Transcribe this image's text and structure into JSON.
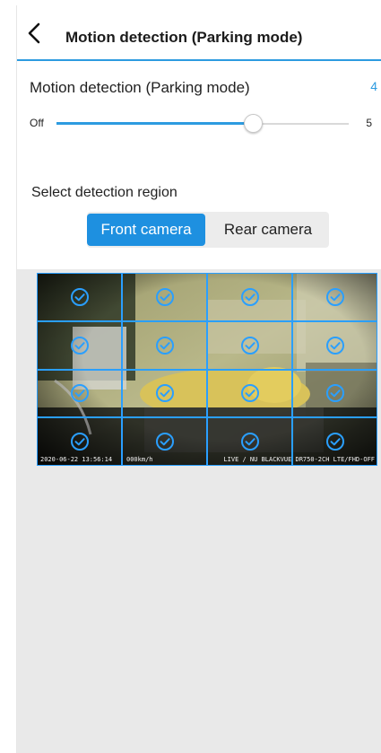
{
  "header": {
    "title": "Motion detection (Parking mode)"
  },
  "setting": {
    "title": "Motion detection (Parking mode)",
    "value": "4",
    "slider": {
      "min_label": "Off",
      "max_label": "5",
      "min": 0,
      "max": 5,
      "value": 4
    }
  },
  "region": {
    "title": "Select detection region",
    "tabs": [
      {
        "label": "Front camera",
        "selected": true
      },
      {
        "label": "Rear camera",
        "selected": false
      }
    ]
  },
  "camera": {
    "timestamp": "2020-06-22 13:56:14",
    "speed": "000km/h",
    "info": "LIVE / NU  BLACKVUE DR750-2CH LTE/FHD-OFF",
    "grid": {
      "rows": 4,
      "cols": 4,
      "cells_selected": 16
    }
  },
  "colors": {
    "accent": "#2d9be0",
    "grid_line": "#2a9fff",
    "segment_selected": "#1e90e0"
  },
  "icons": {
    "back": "chevron-left-icon",
    "cell_check": "check-circle-icon"
  }
}
